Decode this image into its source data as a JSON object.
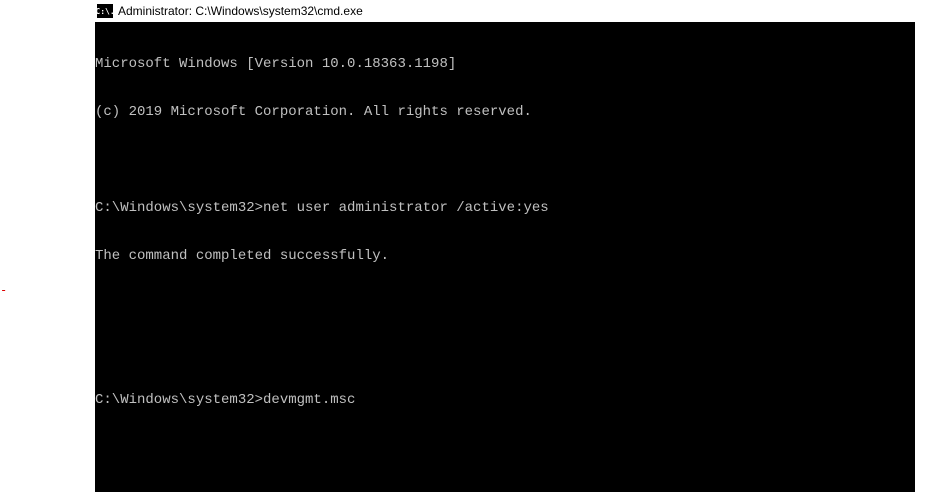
{
  "window": {
    "icon_label": "C:\\.",
    "title": "Administrator: C:\\Windows\\system32\\cmd.exe"
  },
  "terminal": {
    "lines": [
      "Microsoft Windows [Version 10.0.18363.1198]",
      "(c) 2019 Microsoft Corporation. All rights reserved.",
      "",
      "C:\\Windows\\system32>net user administrator /active:yes",
      "The command completed successfully.",
      "",
      "",
      "C:\\Windows\\system32>devmgmt.msc"
    ]
  },
  "artifact": {
    "mark": "-"
  }
}
